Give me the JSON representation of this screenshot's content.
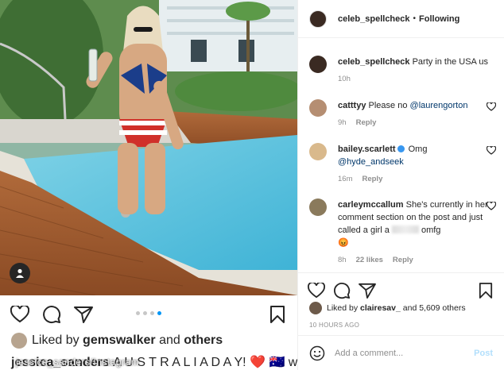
{
  "post": {
    "credit": "jessica_sanders/Instagram",
    "liked_by_prefix": "Liked by",
    "liked_by_user": "gemswalker",
    "liked_by_and": "and",
    "liked_by_others": "others",
    "caption_user": "jessica_sanders",
    "caption_text": "A U S T R A L I A  D A Y! ❤️ 🇦🇺 with",
    "carousel_count": 4,
    "carousel_active": 3
  },
  "header": {
    "username": "celeb_spellcheck",
    "separator": "•",
    "follow_label": "Following"
  },
  "comments": [
    {
      "user": "celeb_spellcheck",
      "text": "Party in the USA us",
      "time": "10h"
    },
    {
      "user": "catttyy",
      "text": "Please no",
      "mention": "@laurengorton",
      "time": "9h",
      "reply": "Reply"
    },
    {
      "user": "bailey.scarlett",
      "text": "Omg",
      "mention": "@hyde_andseek",
      "time": "16m",
      "reply": "Reply"
    },
    {
      "user": "carleymccallum",
      "text_before": "She's currently in her comment section on the post and just called a girl a",
      "text_after": "omfg",
      "emoji": "😡",
      "time": "8h",
      "likes": "22 likes",
      "reply": "Reply"
    }
  ],
  "likes": {
    "prefix": "Liked by",
    "user": "clairesav_",
    "suffix": "and 5,609 others"
  },
  "timestamp": "10 HOURS AGO",
  "add_comment": {
    "placeholder": "Add a comment...",
    "post_label": "Post"
  },
  "icons": {
    "heart": "heart-icon",
    "comment": "comment-icon",
    "share": "share-icon",
    "save": "bookmark-icon",
    "emoji": "emoji-icon",
    "user_tag": "user-tag-icon"
  }
}
